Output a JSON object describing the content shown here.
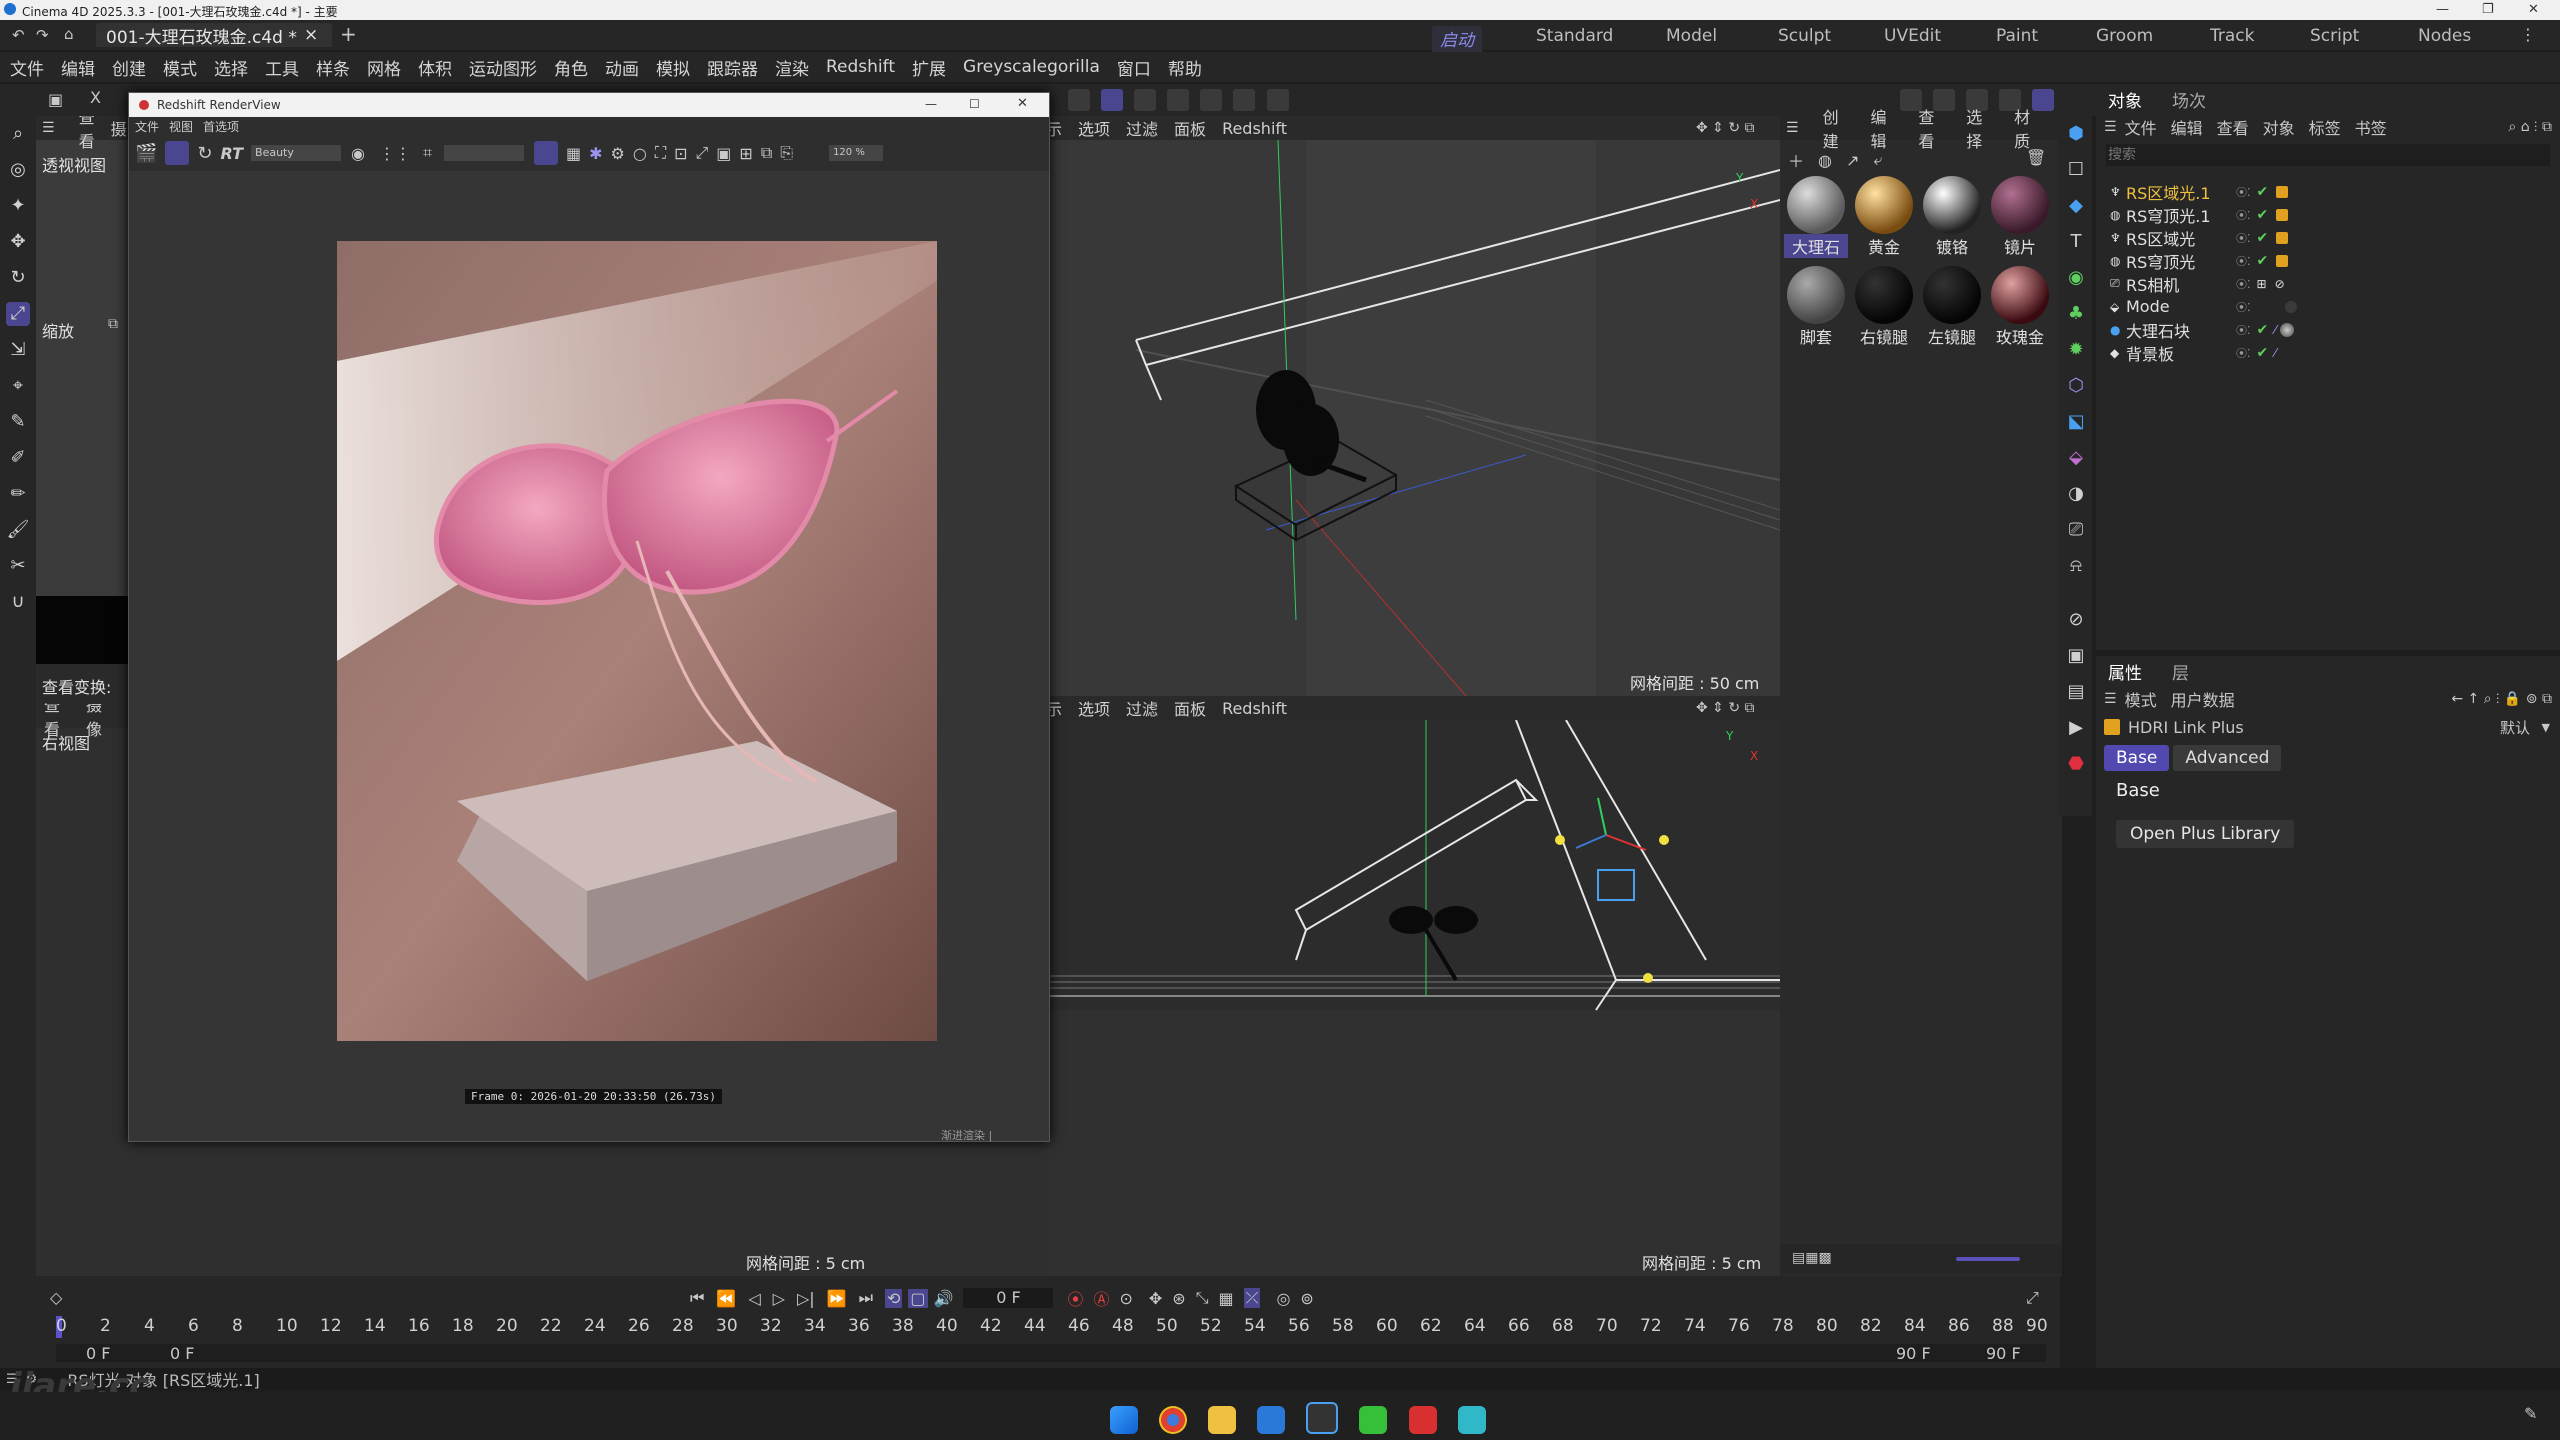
{
  "window": {
    "title": "Cinema 4D 2025.3.3 - [001-大理石玫瑰金.c4d *] - 主要",
    "doc_tab": "001-大理石玫瑰金.c4d *",
    "close_glyph": "×",
    "add_glyph": "+"
  },
  "layouts": [
    "启动",
    "Standard",
    "Model",
    "Sculpt",
    "UVEdit",
    "Paint",
    "Groom",
    "Track",
    "Script",
    "Nodes"
  ],
  "menu": [
    "文件",
    "编辑",
    "创建",
    "模式",
    "选择",
    "工具",
    "样条",
    "网格",
    "体积",
    "运动图形",
    "角色",
    "动画",
    "模拟",
    "跟踪器",
    "渲染",
    "Redshift",
    "扩展",
    "Greyscalegorilla",
    "窗口",
    "帮助"
  ],
  "left_view": {
    "menu": [
      "查看",
      "摄"
    ],
    "name": "透视视图",
    "zoom_label": "缩放",
    "view_transform": "查看变换: 标",
    "bottom_menu": [
      "查看",
      "摄像"
    ],
    "bottom_name": "右视图"
  },
  "viewport_top": {
    "menu": [
      "示",
      "选项",
      "过滤",
      "面板",
      "Redshift"
    ],
    "grid": "网格间距 : 50 cm"
  },
  "viewport_bottom": {
    "menu": [
      "示",
      "选项",
      "过滤",
      "面板",
      "Redshift"
    ],
    "grid": "网格间距 : 5 cm"
  },
  "left_grid": "网格间距 : 5 cm",
  "render_view": {
    "title": "Redshift RenderView",
    "menu": [
      "文件",
      "视图",
      "首选项"
    ],
    "rt_label": "RT",
    "aov": "Beauty",
    "zoom": "120 %",
    "frame_info": "Frame  0:  2026-01-20  20:33:50  (26.73s)",
    "status": "渐进渲染 |"
  },
  "materials": {
    "menu": [
      "创建",
      "编辑",
      "查看",
      "选择",
      "材质"
    ],
    "items": [
      {
        "name": "大理石",
        "color": "#9a9a9a"
      },
      {
        "name": "黄金",
        "color": "#d49a3a"
      },
      {
        "name": "镀铬",
        "color": "#bfbfbf"
      },
      {
        "name": "镜片",
        "color": "#7a3a5a"
      },
      {
        "name": "脚套",
        "color": "#7d7d7d"
      },
      {
        "name": "右镜腿",
        "color": "#111111"
      },
      {
        "name": "左镜腿",
        "color": "#111111"
      },
      {
        "name": "玫瑰金",
        "color": "#8a3a3a"
      }
    ]
  },
  "object_manager": {
    "tabs": [
      "对象",
      "场次"
    ],
    "menu": [
      "文件",
      "编辑",
      "查看",
      "对象",
      "标签",
      "书签"
    ],
    "search_placeholder": "搜索",
    "objects": [
      {
        "name": "RS区域光.1",
        "selected": true
      },
      {
        "name": "RS穹顶光.1",
        "selected": false
      },
      {
        "name": "RS区域光",
        "selected": false
      },
      {
        "name": "RS穹顶光",
        "selected": false
      },
      {
        "name": "RS相机",
        "selected": false
      },
      {
        "name": "Mode",
        "selected": false
      },
      {
        "name": "大理石块",
        "selected": false
      },
      {
        "name": "背景板",
        "selected": false
      }
    ]
  },
  "attributes": {
    "tabs": [
      "属性",
      "层"
    ],
    "menu": [
      "模式",
      "用户数据"
    ],
    "default_label": "默认",
    "object_title": "HDRI Link Plus",
    "subtabs": [
      "Base",
      "Advanced"
    ],
    "section": "Base",
    "library_button": "Open Plus Library"
  },
  "timeline": {
    "frame_field": "0 F",
    "start_a": "0 F",
    "start_b": "0 F",
    "end_a": "90 F",
    "end_b": "90 F",
    "ruler": [
      "0",
      "2",
      "4",
      "6",
      "8",
      "10",
      "12",
      "14",
      "16",
      "18",
      "20",
      "22",
      "24",
      "26",
      "28",
      "30",
      "32",
      "34",
      "36",
      "38",
      "40",
      "42",
      "44",
      "46",
      "48",
      "50",
      "52",
      "54",
      "56",
      "58",
      "60",
      "62",
      "64",
      "66",
      "68",
      "70",
      "72",
      "74",
      "76",
      "78",
      "80",
      "82",
      "84",
      "86",
      "88",
      "90"
    ]
  },
  "status_bar": "RS灯光 对象 [RS区域光.1]",
  "watermark": "iiare.cc",
  "accent": "#6d62d8"
}
